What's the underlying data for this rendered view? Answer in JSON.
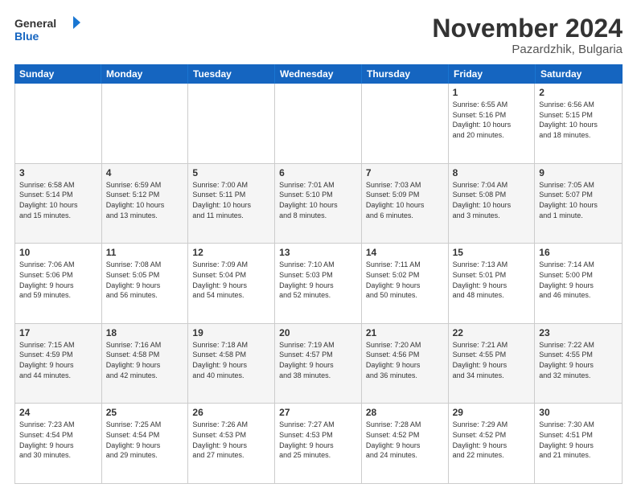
{
  "logo": {
    "general": "General",
    "blue": "Blue"
  },
  "title": "November 2024",
  "location": "Pazardzhik, Bulgaria",
  "days_header": [
    "Sunday",
    "Monday",
    "Tuesday",
    "Wednesday",
    "Thursday",
    "Friday",
    "Saturday"
  ],
  "weeks": [
    [
      {
        "day": "",
        "info": ""
      },
      {
        "day": "",
        "info": ""
      },
      {
        "day": "",
        "info": ""
      },
      {
        "day": "",
        "info": ""
      },
      {
        "day": "",
        "info": ""
      },
      {
        "day": "1",
        "info": "Sunrise: 6:55 AM\nSunset: 5:16 PM\nDaylight: 10 hours\nand 20 minutes."
      },
      {
        "day": "2",
        "info": "Sunrise: 6:56 AM\nSunset: 5:15 PM\nDaylight: 10 hours\nand 18 minutes."
      }
    ],
    [
      {
        "day": "3",
        "info": "Sunrise: 6:58 AM\nSunset: 5:14 PM\nDaylight: 10 hours\nand 15 minutes."
      },
      {
        "day": "4",
        "info": "Sunrise: 6:59 AM\nSunset: 5:12 PM\nDaylight: 10 hours\nand 13 minutes."
      },
      {
        "day": "5",
        "info": "Sunrise: 7:00 AM\nSunset: 5:11 PM\nDaylight: 10 hours\nand 11 minutes."
      },
      {
        "day": "6",
        "info": "Sunrise: 7:01 AM\nSunset: 5:10 PM\nDaylight: 10 hours\nand 8 minutes."
      },
      {
        "day": "7",
        "info": "Sunrise: 7:03 AM\nSunset: 5:09 PM\nDaylight: 10 hours\nand 6 minutes."
      },
      {
        "day": "8",
        "info": "Sunrise: 7:04 AM\nSunset: 5:08 PM\nDaylight: 10 hours\nand 3 minutes."
      },
      {
        "day": "9",
        "info": "Sunrise: 7:05 AM\nSunset: 5:07 PM\nDaylight: 10 hours\nand 1 minute."
      }
    ],
    [
      {
        "day": "10",
        "info": "Sunrise: 7:06 AM\nSunset: 5:06 PM\nDaylight: 9 hours\nand 59 minutes."
      },
      {
        "day": "11",
        "info": "Sunrise: 7:08 AM\nSunset: 5:05 PM\nDaylight: 9 hours\nand 56 minutes."
      },
      {
        "day": "12",
        "info": "Sunrise: 7:09 AM\nSunset: 5:04 PM\nDaylight: 9 hours\nand 54 minutes."
      },
      {
        "day": "13",
        "info": "Sunrise: 7:10 AM\nSunset: 5:03 PM\nDaylight: 9 hours\nand 52 minutes."
      },
      {
        "day": "14",
        "info": "Sunrise: 7:11 AM\nSunset: 5:02 PM\nDaylight: 9 hours\nand 50 minutes."
      },
      {
        "day": "15",
        "info": "Sunrise: 7:13 AM\nSunset: 5:01 PM\nDaylight: 9 hours\nand 48 minutes."
      },
      {
        "day": "16",
        "info": "Sunrise: 7:14 AM\nSunset: 5:00 PM\nDaylight: 9 hours\nand 46 minutes."
      }
    ],
    [
      {
        "day": "17",
        "info": "Sunrise: 7:15 AM\nSunset: 4:59 PM\nDaylight: 9 hours\nand 44 minutes."
      },
      {
        "day": "18",
        "info": "Sunrise: 7:16 AM\nSunset: 4:58 PM\nDaylight: 9 hours\nand 42 minutes."
      },
      {
        "day": "19",
        "info": "Sunrise: 7:18 AM\nSunset: 4:58 PM\nDaylight: 9 hours\nand 40 minutes."
      },
      {
        "day": "20",
        "info": "Sunrise: 7:19 AM\nSunset: 4:57 PM\nDaylight: 9 hours\nand 38 minutes."
      },
      {
        "day": "21",
        "info": "Sunrise: 7:20 AM\nSunset: 4:56 PM\nDaylight: 9 hours\nand 36 minutes."
      },
      {
        "day": "22",
        "info": "Sunrise: 7:21 AM\nSunset: 4:55 PM\nDaylight: 9 hours\nand 34 minutes."
      },
      {
        "day": "23",
        "info": "Sunrise: 7:22 AM\nSunset: 4:55 PM\nDaylight: 9 hours\nand 32 minutes."
      }
    ],
    [
      {
        "day": "24",
        "info": "Sunrise: 7:23 AM\nSunset: 4:54 PM\nDaylight: 9 hours\nand 30 minutes."
      },
      {
        "day": "25",
        "info": "Sunrise: 7:25 AM\nSunset: 4:54 PM\nDaylight: 9 hours\nand 29 minutes."
      },
      {
        "day": "26",
        "info": "Sunrise: 7:26 AM\nSunset: 4:53 PM\nDaylight: 9 hours\nand 27 minutes."
      },
      {
        "day": "27",
        "info": "Sunrise: 7:27 AM\nSunset: 4:53 PM\nDaylight: 9 hours\nand 25 minutes."
      },
      {
        "day": "28",
        "info": "Sunrise: 7:28 AM\nSunset: 4:52 PM\nDaylight: 9 hours\nand 24 minutes."
      },
      {
        "day": "29",
        "info": "Sunrise: 7:29 AM\nSunset: 4:52 PM\nDaylight: 9 hours\nand 22 minutes."
      },
      {
        "day": "30",
        "info": "Sunrise: 7:30 AM\nSunset: 4:51 PM\nDaylight: 9 hours\nand 21 minutes."
      }
    ]
  ]
}
